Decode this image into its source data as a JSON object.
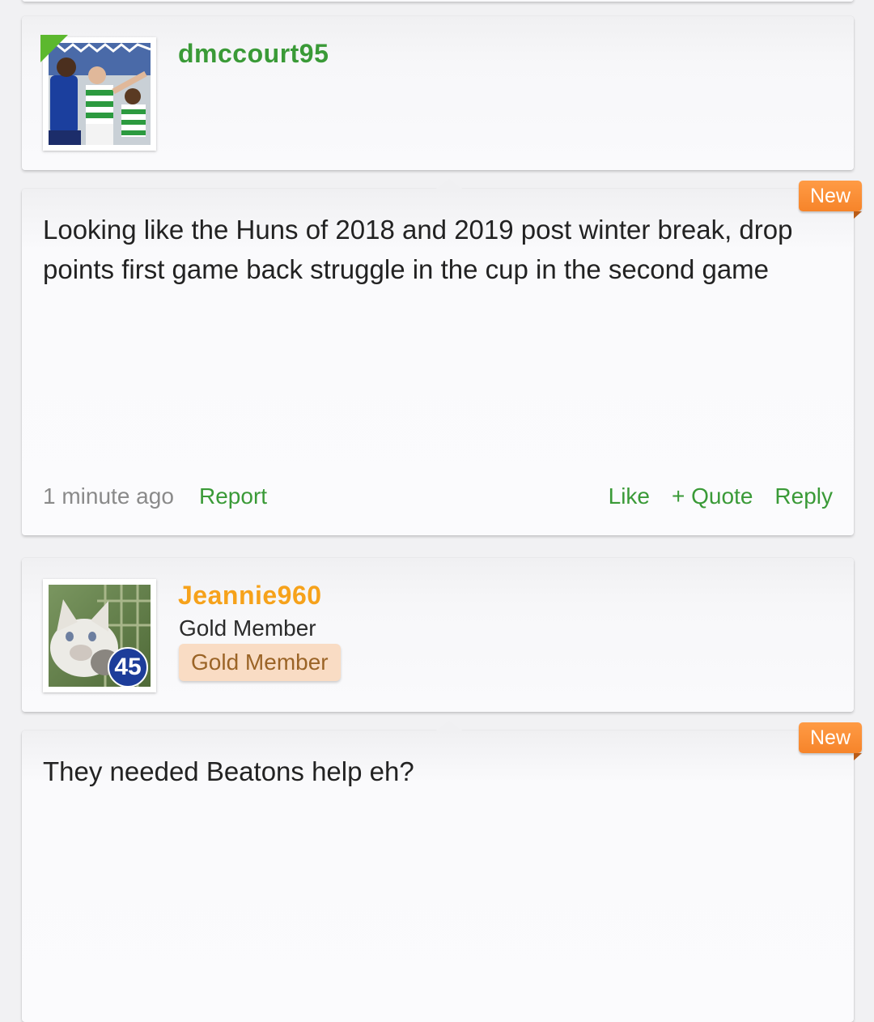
{
  "posts": [
    {
      "username": "dmccourt95",
      "username_color": "#3a9a37",
      "online": true,
      "avatar_icon": "football-players-avatar",
      "new_badge": "New",
      "body": "Looking like the Huns of 2018 and 2019 post winter break, drop points first game back struggle in the cup in the second game",
      "time": "1 minute ago",
      "report_label": "Report",
      "like_label": "Like",
      "quote_label": "+ Quote",
      "reply_label": "Reply"
    },
    {
      "username": "Jeannie960",
      "username_color": "#f6a21b",
      "rank": "Gold Member",
      "rank_badge": "Gold Member",
      "avatar_icon": "kitten-avatar",
      "avatar_level": "45",
      "new_badge": "New",
      "body": "They needed Beatons help eh?"
    }
  ],
  "colors": {
    "accent_green": "#3a9a37",
    "new_badge_orange": "#f6842a",
    "gold_badge_bg": "#f9dcc4"
  }
}
